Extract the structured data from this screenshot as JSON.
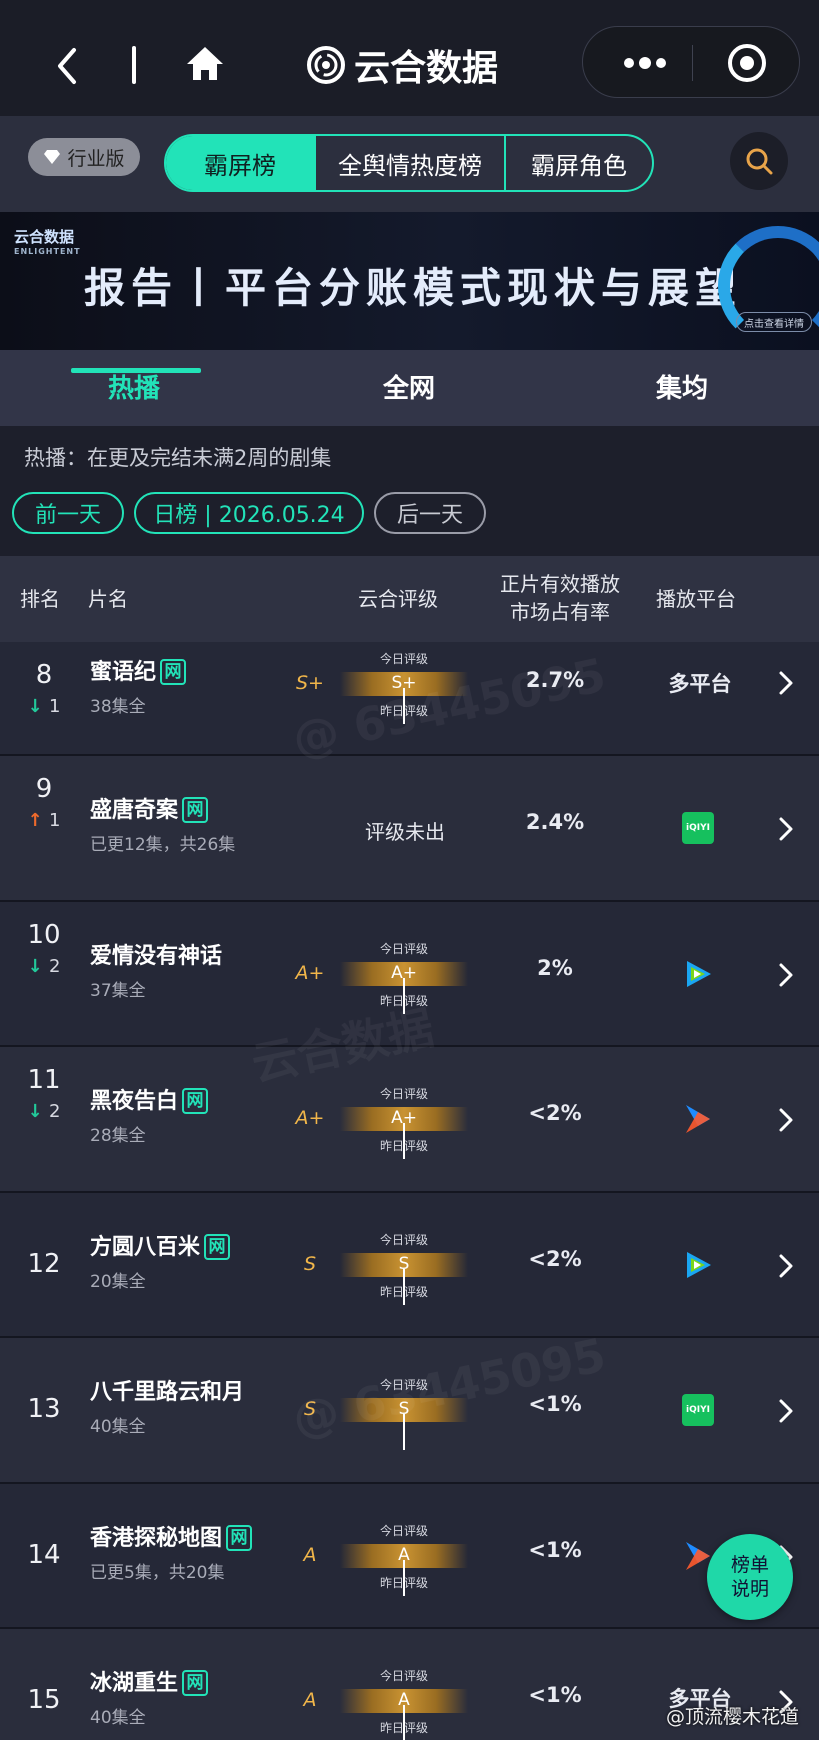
{
  "nav": {
    "app_title": "云合数据"
  },
  "filters": {
    "industry_label": "行业版",
    "segments": [
      "霸屏榜",
      "全舆情热度榜",
      "霸屏角色"
    ]
  },
  "banner": {
    "logo": "云合数据",
    "logo_en": "ENLIGHTENT",
    "title": "报告丨平台分账模式现状与展望",
    "button": "点击查看详情"
  },
  "subtabs": [
    "热播",
    "全网",
    "集均"
  ],
  "description": "热播：在更及完结未满2周的剧集",
  "date_nav": {
    "prev": "前一天",
    "current": "日榜 | 2026.05.24",
    "next": "后一天"
  },
  "table_header": {
    "rank": "排名",
    "title": "片名",
    "rating": "云合评级",
    "share_line1": "正片有效播放",
    "share_line2": "市场占有率",
    "platform": "播放平台"
  },
  "rating_labels": {
    "today": "今日评级",
    "yesterday": "昨日评级"
  },
  "rows": [
    {
      "rank": "8",
      "move": "1",
      "dir": "down",
      "title": "蜜语纪",
      "net": "网",
      "episodes": "38集全",
      "grade": "S+",
      "today": "S+",
      "share": "2.7%",
      "platform": "多平台"
    },
    {
      "rank": "9",
      "move": "1",
      "dir": "up",
      "title": "盛唐奇案",
      "net": "网",
      "episodes": "已更12集，共26集",
      "rating_text": "评级未出",
      "share": "2.4%",
      "platform_icon": "iqiyi-icon",
      "iqiyi_label": "iQIYI"
    },
    {
      "rank": "10",
      "move": "2",
      "dir": "down",
      "title": "爱情没有神话",
      "episodes": "37集全",
      "grade": "A+",
      "today": "A+",
      "share": "2%",
      "platform_icon": "tencent-video-icon"
    },
    {
      "rank": "11",
      "move": "2",
      "dir": "down",
      "title": "黑夜告白",
      "net": "网",
      "episodes": "28集全",
      "grade": "A+",
      "today": "A+",
      "share": "<2%",
      "platform_icon": "youku-icon"
    },
    {
      "rank": "12",
      "title": "方圆八百米",
      "net": "网",
      "episodes": "20集全",
      "grade": "S",
      "today": "S",
      "share": "<2%",
      "platform_icon": "tencent-video-icon"
    },
    {
      "rank": "13",
      "title": "八千里路云和月",
      "episodes": "40集全",
      "grade": "S",
      "today": "S",
      "share": "<1%",
      "platform_icon": "iqiyi-icon",
      "iqiyi_label": "iQIYI"
    },
    {
      "rank": "14",
      "title": "香港探秘地图",
      "net": "网",
      "episodes": "已更5集，共20集",
      "grade": "A",
      "today": "A",
      "share": "<1%",
      "platform_icon": "youku-icon"
    },
    {
      "rank": "15",
      "title": "冰湖重生",
      "net": "网",
      "episodes": "40集全",
      "grade": "A",
      "today": "A",
      "share": "<1%",
      "platform": "多平台"
    }
  ],
  "legend_button": {
    "line1": "榜单",
    "line2": "说明"
  },
  "footer_mark": "@顶流樱木花道",
  "watermarks": [
    "@ 63445095",
    "云合数据",
    "ENLIGHTENT"
  ],
  "colors": {
    "accent": "#22e3b8",
    "grade": "#f1b64a",
    "down": "#22c99a",
    "up": "#ee6a2c",
    "background": "#1d1f2b"
  }
}
